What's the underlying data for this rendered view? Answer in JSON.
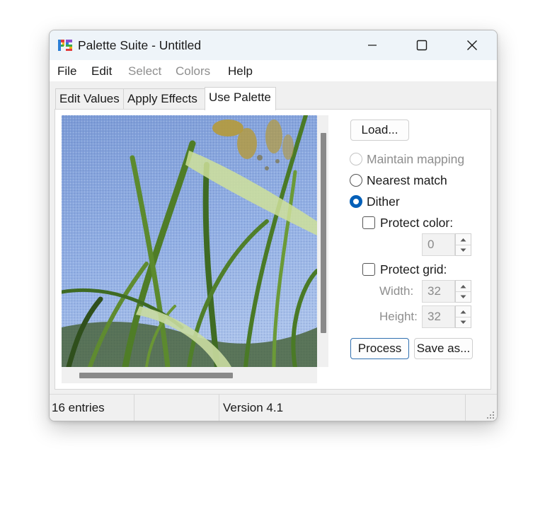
{
  "window": {
    "title": "Palette Suite - Untitled",
    "icon": "palette-suite-icon"
  },
  "menu": [
    {
      "label": "File",
      "enabled": true
    },
    {
      "label": "Edit",
      "enabled": true
    },
    {
      "label": "Select",
      "enabled": false
    },
    {
      "label": "Colors",
      "enabled": false
    },
    {
      "label": "Help",
      "enabled": true
    }
  ],
  "tabs": [
    {
      "label": "Edit Values",
      "active": false
    },
    {
      "label": "Apply Effects",
      "active": false
    },
    {
      "label": "Use Palette",
      "active": true
    }
  ],
  "controls": {
    "load_label": "Load...",
    "mapping": {
      "maintain": "Maintain mapping",
      "nearest": "Nearest match",
      "dither": "Dither",
      "selected": "dither"
    },
    "protect_color": {
      "label": "Protect color:",
      "checked": false,
      "value": "0"
    },
    "protect_grid": {
      "label": "Protect grid:",
      "checked": false,
      "width_label": "Width:",
      "width_value": "32",
      "height_label": "Height:",
      "height_value": "32"
    },
    "process_label": "Process",
    "save_label": "Save as..."
  },
  "status": {
    "entries": "16 entries",
    "middle": "",
    "version": "Version 4.1"
  },
  "colors": {
    "accent": "#005fb8",
    "default_button_border": "#2f6fb0"
  }
}
